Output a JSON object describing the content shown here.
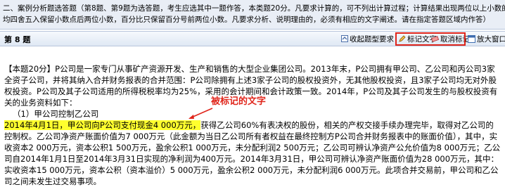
{
  "instructions": {
    "line1": "二、案例分析题选答题（第8题、第9题为选答题，考生应选其中一题作答，本类题20分。凡要求计算的，可不列出计算过程；计算结果出现两位以上小数的，",
    "line2": "均四舍五入保留小数点后两位小数，百分比只保留百分号前两位小数。凡要求分析、说明理由的，必须有相应的文字阐述。请在指定答题区域内作答）"
  },
  "question_bar": {
    "title": "第 8 题",
    "collapse_label": "收起题型要求",
    "mark_text_label": "标记文字",
    "unmark_label": "取消标记",
    "zoom_window_label": "放大窗口"
  },
  "content": {
    "p1": "【本题20分】P公司是一家专门从事矿产资源开发、生产和销售的大型企业集团公司。2013年末，P公司拥有甲公司、乙公司和丙公司3家全资子公司，并将其纳入合并财务报表的合并范围：P公司除拥有上述3家子公司的股权投资外，无其他股权投资，且3家子公司均无对外股权投资。P公司及其子公司适用的所得税税率均为25%，采用的会计期间和会计政策一致。2014年，P公司及其子公司发生的与股权投资有关的业务资料如下：",
    "p2": "（1）甲公司控制乙公司",
    "highlighted": "2014年4月1日，甲公司向P公司支付现金4 000万元，",
    "p3_rest": "获得乙公司60%有表决权的股份，相关的产权交接手续办理完毕，取得对乙公司的控制权。乙公司净资产账面价值为7 000万元（此金额为当日乙公司所有者权益在最终控制方P公司合并财务报表中的账面价值），其中，实收资本2 000万元，资本公积1 500万元，盈余公积1 000万元，未分配利润2 500万元；乙公司可辨认净资产公允价值为8 000万元；乙公司自2014年1月1日至2014年3月31日实现的净利润为400万元。2014年3月31日，甲公司可辨认净资产账面价值为28 000万元，其中：实收资本15 000万元，资本公积（资本溢价）5 000万元，盈余公积2 000万元，未分配利润6 000万元。此项合并交易前，甲公司和乙公司之间未发生过交易事项。"
  },
  "annotation": {
    "label": "被标记的文字",
    "color": "#e0251b"
  },
  "colors": {
    "highlight": "#ffff2e",
    "instructions_bg": "#e9eef6"
  }
}
